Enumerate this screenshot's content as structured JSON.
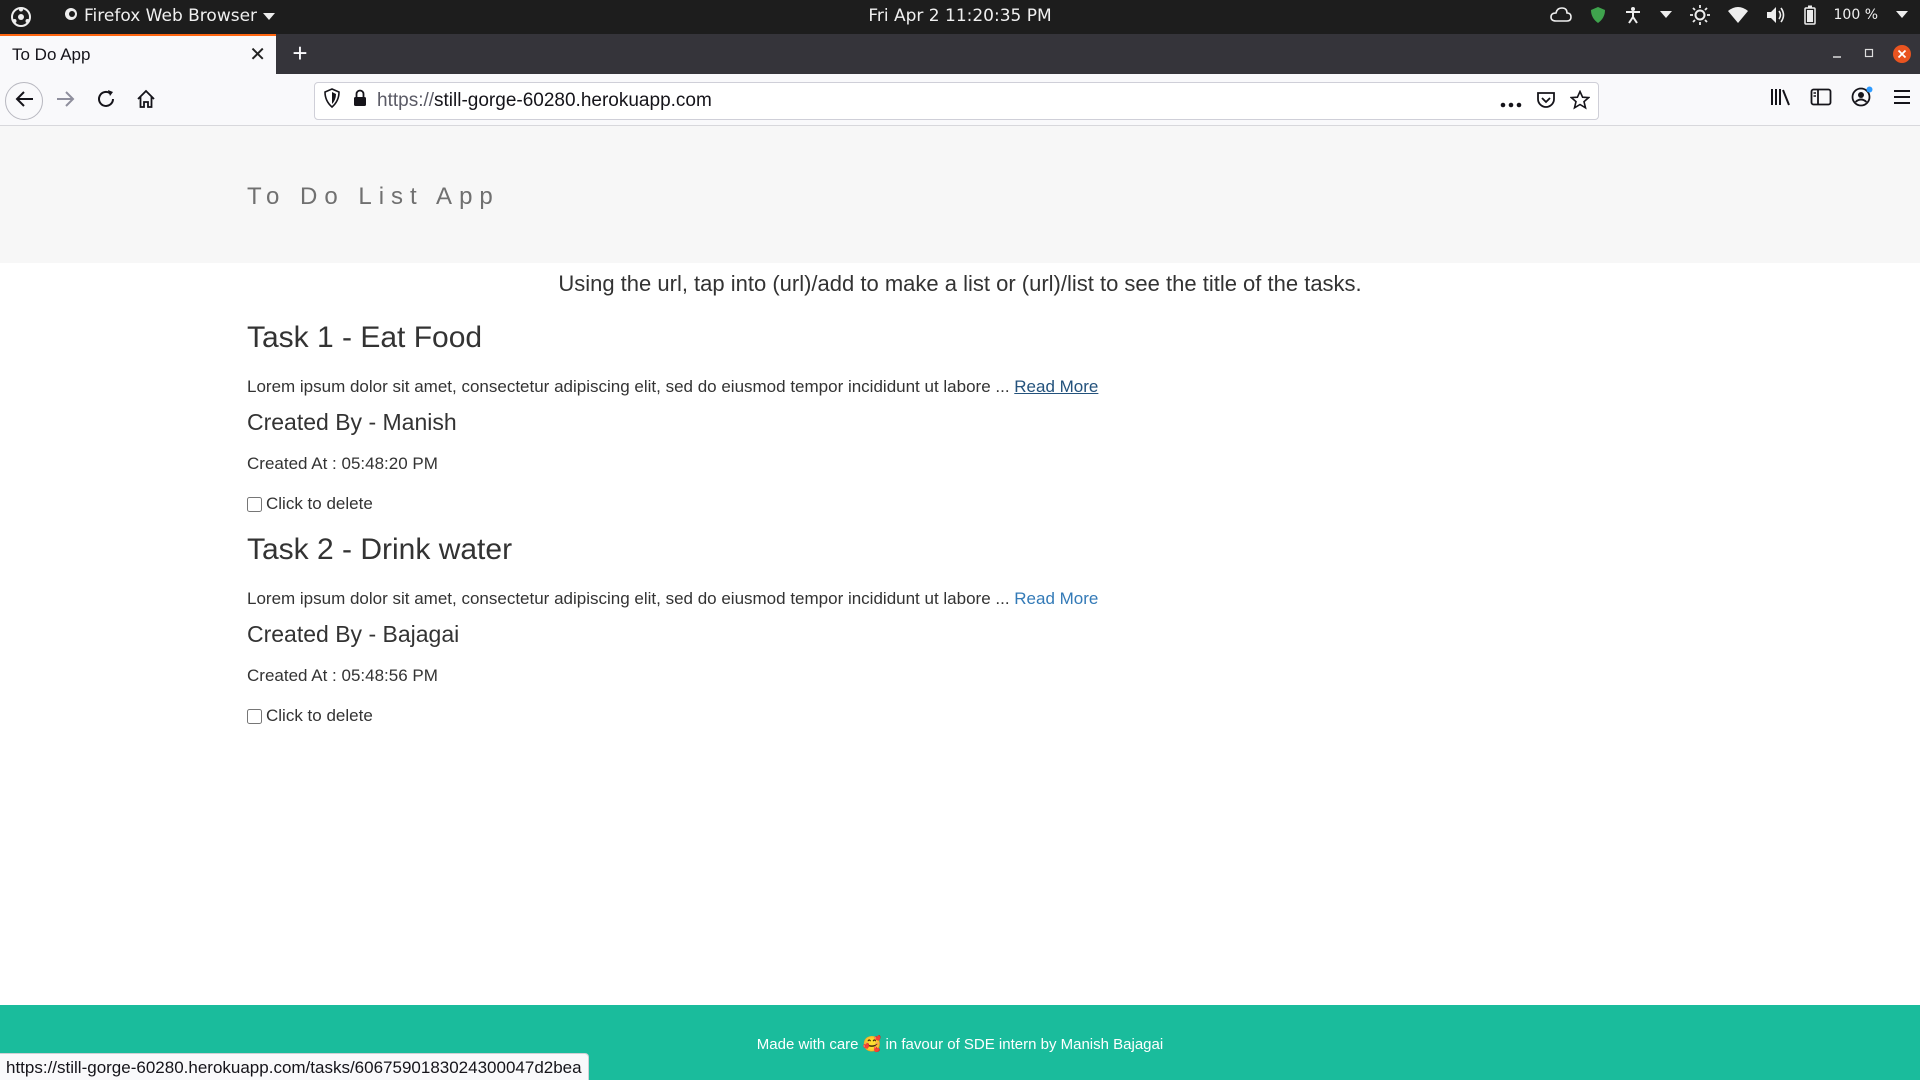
{
  "system_bar": {
    "app_menu": "Firefox Web Browser",
    "clock": "Fri Apr 2  11:20:35 PM",
    "battery": "100 %"
  },
  "browser": {
    "tab_title": "To Do App",
    "url_protocol": "https://",
    "url_host": "still-gorge-60280.herokuapp.com",
    "status_url": "https://still-gorge-60280.herokuapp.com/tasks/6067590183024300047d2bea"
  },
  "page": {
    "brand": "To Do List App",
    "lead": "Using the url, tap into (url)/add to make a list or (url)/list to see the title of the tasks.",
    "tasks": [
      {
        "title": "Task 1 - Eat Food",
        "description": "Lorem ipsum dolor sit amet, consectetur adipiscing elit, sed do eiusmod tempor incididunt ut labore ... ",
        "read_more": "Read More",
        "created_by": "Created By - Manish",
        "created_at": "Created At : 05:48:20 PM",
        "delete_label": "Click to delete"
      },
      {
        "title": "Task 2 - Drink water",
        "description": "Lorem ipsum dolor sit amet, consectetur adipiscing elit, sed do eiusmod tempor incididunt ut labore ... ",
        "read_more": "Read More",
        "created_by": "Created By - Bajagai",
        "created_at": "Created At : 05:48:56 PM",
        "delete_label": "Click to delete"
      }
    ],
    "footer_before": "Made with care ",
    "footer_emoji": "🥰",
    "footer_after": " in favour of SDE intern by Manish Bajagai"
  },
  "colors": {
    "footer_bg": "#1abc9c",
    "link": "#337ab7",
    "tab_accent": "#ff6611"
  }
}
